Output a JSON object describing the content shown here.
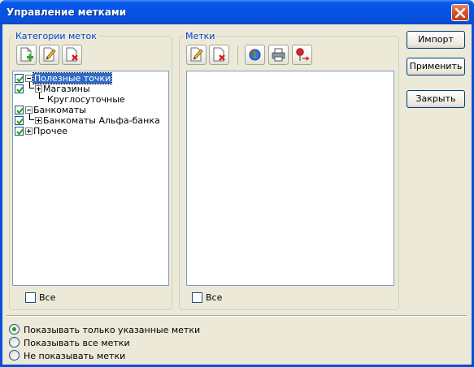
{
  "window": {
    "title": "Управление метками"
  },
  "categories_group": {
    "legend": "Категории меток",
    "toolbar": [
      "add-category-icon",
      "edit-category-icon",
      "delete-category-icon"
    ],
    "tree": [
      {
        "label": "Полезные точки",
        "checked": true,
        "expander": "minus",
        "selected": true
      },
      {
        "label": "Магазины",
        "checked": true,
        "expander": "plus"
      },
      {
        "label": "Круглосуточные",
        "checked": false,
        "expander": "none"
      },
      {
        "label": "Банкоматы",
        "checked": true,
        "expander": "minus"
      },
      {
        "label": "Банкоматы Альфа-банка",
        "checked": true,
        "expander": "plus"
      },
      {
        "label": "Прочее",
        "checked": true,
        "expander": "plus"
      }
    ],
    "all_label": "Все",
    "all_checked": false
  },
  "marks_group": {
    "legend": "Метки",
    "toolbar": [
      "edit-mark-icon",
      "delete-mark-icon",
      "globe-icon",
      "printer-icon",
      "red-pin-icon"
    ],
    "items": [],
    "all_label": "Все",
    "all_checked": false
  },
  "buttons": {
    "import": "Импорт",
    "apply": "Применить",
    "close": "Закрыть"
  },
  "display_mode": {
    "options": [
      "Показывать только указанные метки",
      "Показывать все метки",
      "Не показывать метки"
    ],
    "selected_index": 0
  },
  "colors": {
    "titlebar": "#0553E2",
    "group_legend": "#0046D5",
    "selection": "#316AC5",
    "dialog_bg": "#ECE9D8"
  }
}
